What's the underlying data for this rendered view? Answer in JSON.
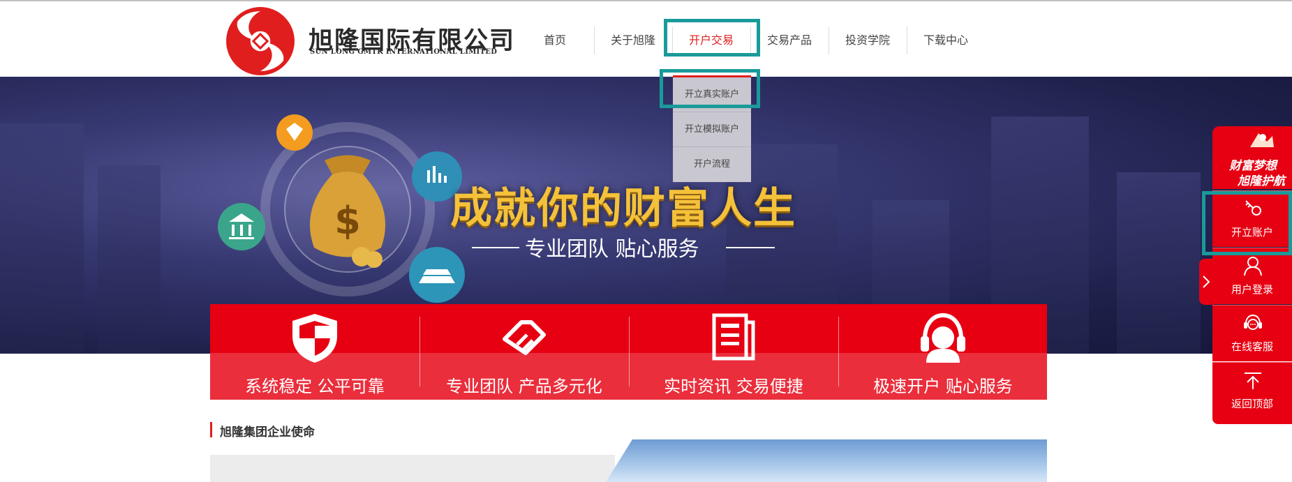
{
  "header": {
    "company_name": "旭隆国际有限公司",
    "company_name_en": "SUN LONG GMTK INTERNATIONAL LIMITED",
    "nav": [
      {
        "label": "首页"
      },
      {
        "label": "关于旭隆"
      },
      {
        "label": "开户交易"
      },
      {
        "label": "交易产品"
      },
      {
        "label": "投资学院"
      },
      {
        "label": "下载中心"
      }
    ],
    "active_nav": "开户交易"
  },
  "dropdown": {
    "items": [
      "开立真实账户",
      "开立模拟账户",
      "开户流程"
    ]
  },
  "banner": {
    "slogan_main": "成就你的财富人生",
    "slogan_sub": "专业团队 贴心服务"
  },
  "features": [
    {
      "label": "系统稳定 公平可靠",
      "icon": "shield-icon"
    },
    {
      "label": "专业团队 产品多元化",
      "icon": "handshake-icon"
    },
    {
      "label": "实时资讯 交易便捷",
      "icon": "document-icon"
    },
    {
      "label": "极速开户 贴心服务",
      "icon": "headset-icon"
    }
  ],
  "mission": {
    "title": "旭隆集团企业使命"
  },
  "sidebar": {
    "slogan_line1": "财富梦想",
    "slogan_line2": "旭隆护航",
    "items": [
      {
        "label": "开立账户",
        "icon": "key-icon"
      },
      {
        "label": "用户登录",
        "icon": "user-icon"
      },
      {
        "label": "在线客服",
        "icon": "chat-icon"
      },
      {
        "label": "返回顶部",
        "icon": "arrow-up-icon"
      }
    ]
  },
  "colors": {
    "brand_red": "#e60012",
    "highlight_teal": "#1a9a9a",
    "banner_navy": "#23255a",
    "gold": "#f4c13a"
  }
}
